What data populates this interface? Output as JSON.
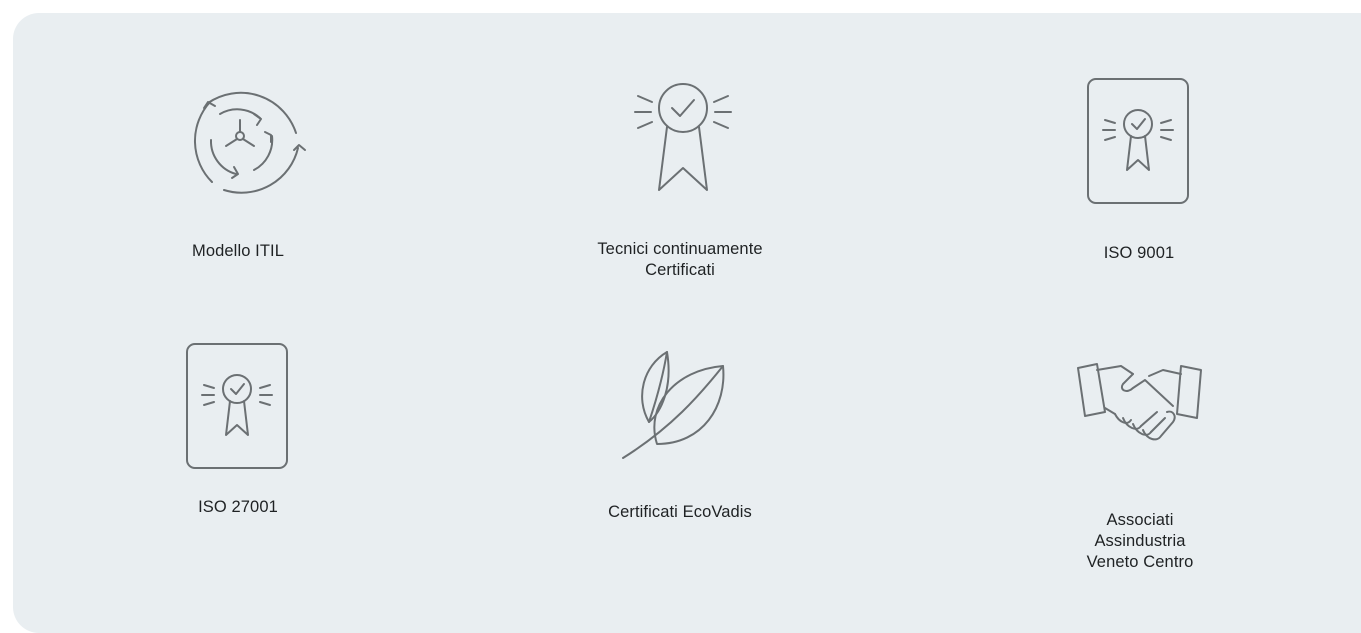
{
  "features": [
    {
      "label": "Modello ITIL",
      "icon": "cycle-arrows-icon"
    },
    {
      "label": "Tecnici continuamente\nCertificati",
      "icon": "award-ribbon-icon"
    },
    {
      "label": "ISO 9001",
      "icon": "certificate-document-icon"
    },
    {
      "label": "ISO 27001",
      "icon": "certificate-document-icon"
    },
    {
      "label": "Certificati EcoVadis",
      "icon": "leaves-icon"
    },
    {
      "label": "Associati\nAssindustria\nVeneto Centro",
      "icon": "handshake-icon"
    }
  ],
  "colors": {
    "panel": "#e9eef1",
    "icon": "#6b7073",
    "text": "#1f2224"
  }
}
